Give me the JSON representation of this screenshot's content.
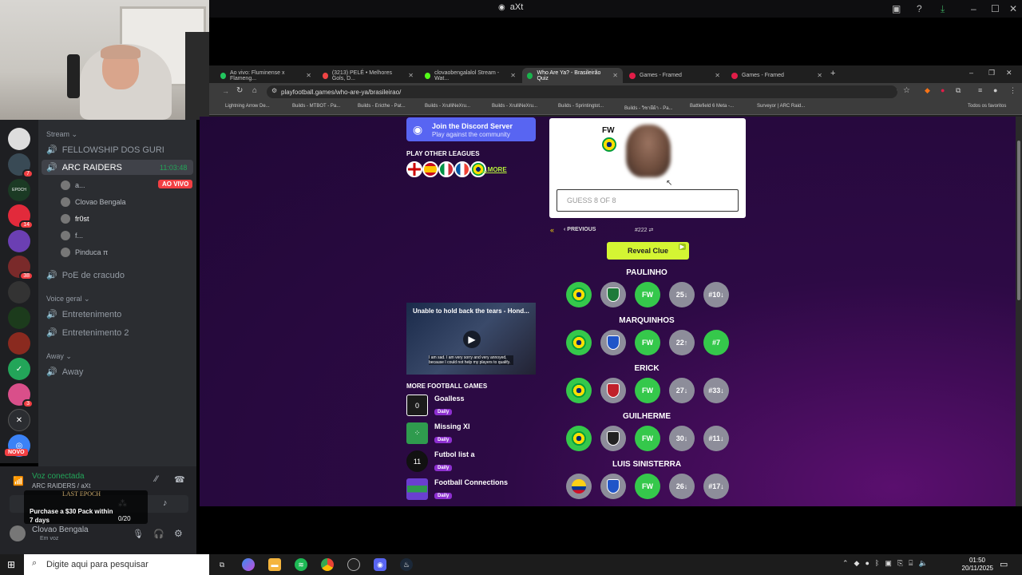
{
  "app": {
    "title": "aXt"
  },
  "discord": {
    "stream_category": "Stream",
    "channels_top": [
      {
        "name": "FELLOWSHIP DOS GURI"
      },
      {
        "name": "ARC RAIDERS",
        "timer": "11:03:48"
      }
    ],
    "live_badge": "AO VIVO",
    "voice_users": [
      "a...",
      "Clovao Bengala",
      "fr0st",
      "f...",
      "Pinduca π"
    ],
    "channel_poe": "PoE de cracudo",
    "voice_category": "Voice geral",
    "voice_channels": [
      "Entretenimento",
      "Entretenimento 2"
    ],
    "away_category": "Away",
    "away_channel": "Away",
    "server_badges": [
      "7",
      "14",
      "38",
      "3"
    ],
    "novo_badge": "NOVO",
    "voice_connected": "Voz conectada",
    "voice_location": "ARC RAIDERS / aXt",
    "promo_logo": "LAST EPOCH",
    "promo_text": "Purchase a $30 Pack within 7 days",
    "promo_progress": "0/20",
    "current_user": "Clovao Bengala",
    "current_status": "Em voz"
  },
  "browser": {
    "tabs": [
      {
        "title": "Ao vivo: Fluminense x Flameng...",
        "color": "#22c55e"
      },
      {
        "title": "(3213) PELÉ • Melhores Gols, D...",
        "color": "#ef4444"
      },
      {
        "title": "clovaobengalalol Stream - Wat...",
        "color": "#53fc18"
      },
      {
        "title": "Who Are Ya? - Brasileirão Quiz",
        "color": "#19b34c"
      },
      {
        "title": "Games - Framed",
        "color": "#e11d48"
      },
      {
        "title": "Games - Framed",
        "color": "#e11d48"
      }
    ],
    "url": "playfootball.games/who-are-ya/brasileirao/",
    "bookmarks": [
      "Lightning Arrow De...",
      "Builds - MTBOT - Pa...",
      "Builds - Ericthe - Pat...",
      "Builds - XrulliNeXru...",
      "Builds - XrulliNeXru...",
      "Builds - Sprintingtot...",
      "Builds - วิชาผีผ้า - Pa...",
      "Battlefield 6 Meta -...",
      "Surveyor | ARC Raid..."
    ],
    "all_favorites": "Todos os favoritos"
  },
  "page": {
    "discord_cta_title": "Join the Discord Server",
    "discord_cta_sub": "Play against the community",
    "play_other_leagues": "PLAY OTHER LEAGUES",
    "more_link": "...MORE",
    "video_title": "Unable to hold back the tears - Hond...",
    "video_subtitle": "I am sad. I am very sorry and very annoyed, because I could not help my players to qualify.",
    "more_games_heading": "MORE FOOTBALL GAMES",
    "games": [
      {
        "name": "Goalless",
        "tag": "Daily",
        "icon": "0"
      },
      {
        "name": "Missing XI",
        "tag": "Daily",
        "icon": ""
      },
      {
        "name": "Futbol list a",
        "tag": "Daily",
        "icon": "11"
      },
      {
        "name": "Football Connections",
        "tag": "Daily",
        "icon": ""
      }
    ],
    "position": "FW",
    "guess_placeholder": "GUESS 8 OF 8",
    "previous": "PREVIOUS",
    "puzzle_number": "#222",
    "reveal_clue": "Reveal Clue",
    "guesses": [
      {
        "name": "PAULINHO",
        "pos": "FW",
        "age": "25↓",
        "shirt": "#10↓",
        "nat_green": true,
        "club_green": false,
        "shirt_green": false
      },
      {
        "name": "MARQUINHOS",
        "pos": "FW",
        "age": "22↑",
        "shirt": "#7",
        "nat_green": true,
        "club_green": false,
        "shirt_green": true
      },
      {
        "name": "ERICK",
        "pos": "FW",
        "age": "27↓",
        "shirt": "#33↓",
        "nat_green": true,
        "club_green": false,
        "shirt_green": false
      },
      {
        "name": "GUILHERME",
        "pos": "FW",
        "age": "30↓",
        "shirt": "#11↓",
        "nat_green": true,
        "club_green": false,
        "shirt_green": false
      },
      {
        "name": "LUIS SINISTERRA",
        "pos": "FW",
        "age": "26↓",
        "shirt": "#17↓",
        "nat_green": false,
        "club_green": false,
        "shirt_green": false
      }
    ]
  },
  "taskbar": {
    "search_placeholder": "Digite aqui para pesquisar",
    "time": "01:50",
    "date": "20/11/2025"
  }
}
